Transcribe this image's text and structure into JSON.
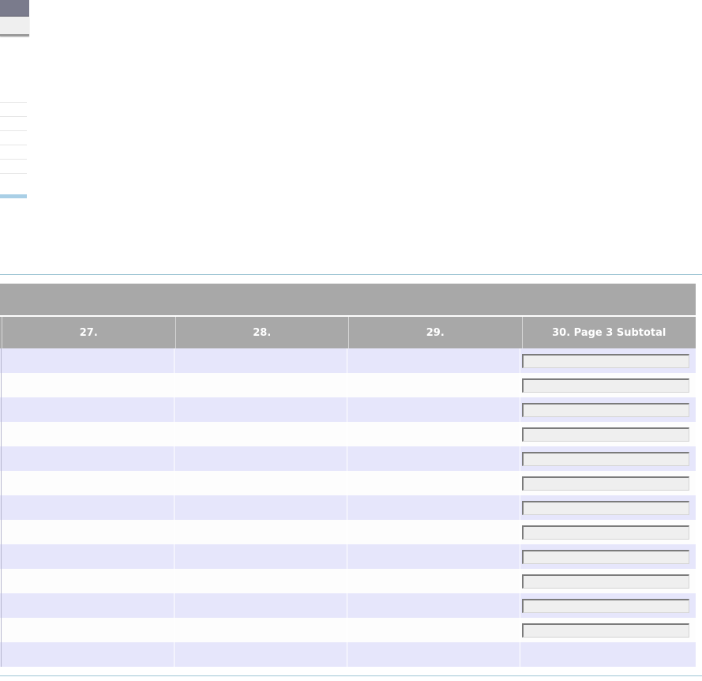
{
  "table": {
    "headers": [
      "27.",
      "28.",
      "29.",
      "30. Page 3 Subtotal"
    ],
    "subtotal_fields": [
      "",
      "",
      "",
      "",
      "",
      "",
      "",
      "",
      "",
      "",
      "",
      ""
    ]
  }
}
